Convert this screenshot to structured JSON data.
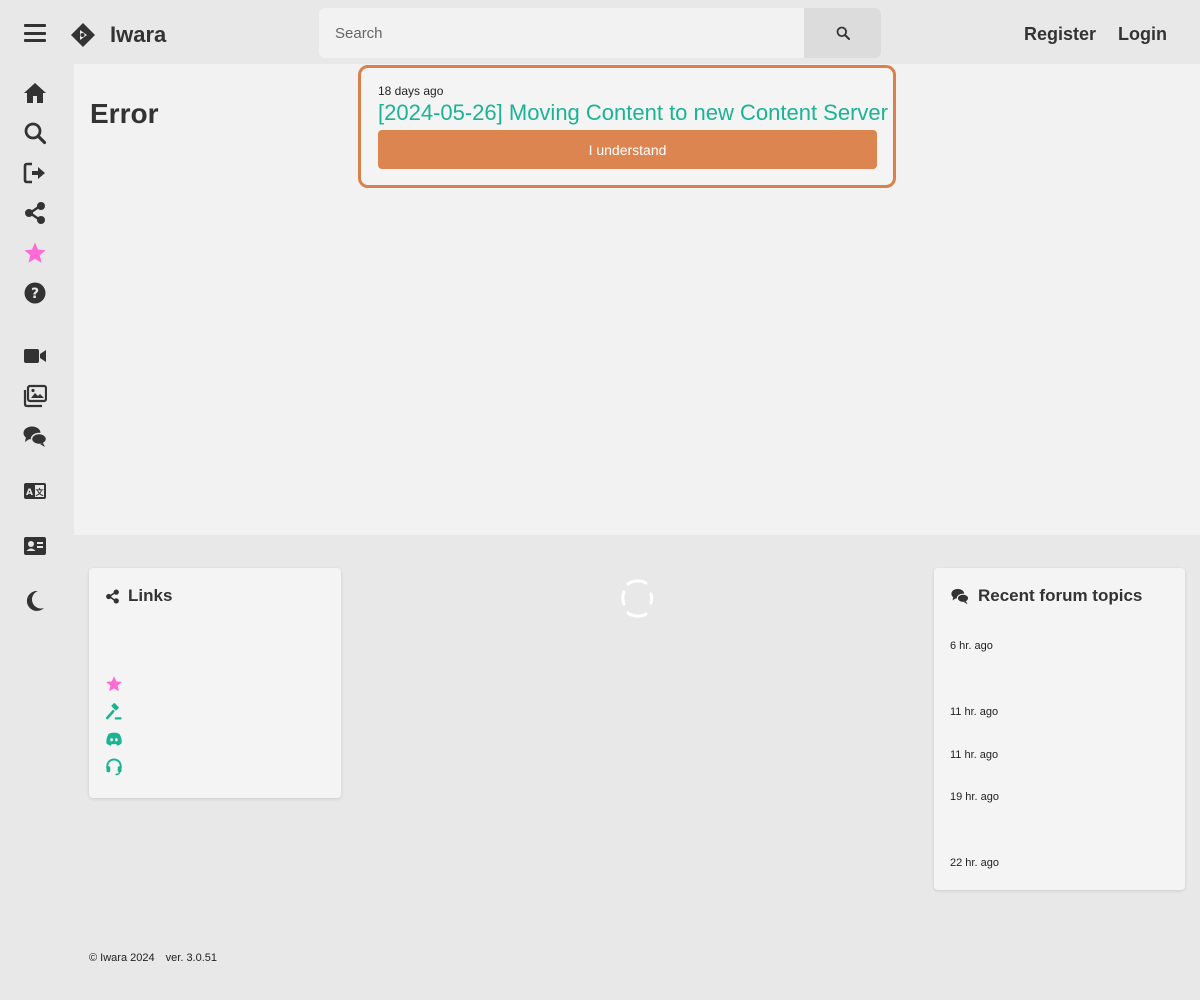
{
  "header": {
    "brand": "Iwara",
    "search_placeholder": "Search",
    "register_label": "Register",
    "login_label": "Login"
  },
  "sidebar": {
    "items": [
      {
        "name": "home",
        "icon": "home-icon"
      },
      {
        "name": "search",
        "icon": "search-icon"
      },
      {
        "name": "login",
        "icon": "sign-in-icon"
      },
      {
        "name": "share",
        "icon": "share-icon"
      },
      {
        "name": "premium",
        "icon": "star-icon"
      },
      {
        "name": "help",
        "icon": "question-icon"
      },
      {
        "name": "videos",
        "icon": "video-icon"
      },
      {
        "name": "images",
        "icon": "images-icon"
      },
      {
        "name": "forum",
        "icon": "comments-icon"
      },
      {
        "name": "translate",
        "icon": "language-icon"
      },
      {
        "name": "profile",
        "icon": "id-card-icon"
      },
      {
        "name": "theme",
        "icon": "moon-icon"
      }
    ]
  },
  "main": {
    "title": "Error"
  },
  "notice": {
    "time": "18 days ago",
    "title": "[2024-05-26] Moving Content to new Content Server",
    "button_label": "I understand"
  },
  "links_card": {
    "title": "Links",
    "icons": [
      "star-icon",
      "gavel-icon",
      "discord-icon",
      "headset-icon"
    ]
  },
  "forum_card": {
    "title": "Recent forum topics",
    "topics": [
      {
        "time": "6 hr. ago"
      },
      {
        "time": "11 hr. ago"
      },
      {
        "time": "11 hr. ago"
      },
      {
        "time": "19 hr. ago"
      },
      {
        "time": "22 hr. ago"
      }
    ]
  },
  "footer": {
    "copyright": "© Iwara 2024",
    "version": "ver. 3.0.51"
  },
  "colors": {
    "accent_orange": "#dc8550",
    "accent_teal": "#1ab394",
    "accent_pink": "#ff6ad5",
    "text_dark": "#333333"
  }
}
